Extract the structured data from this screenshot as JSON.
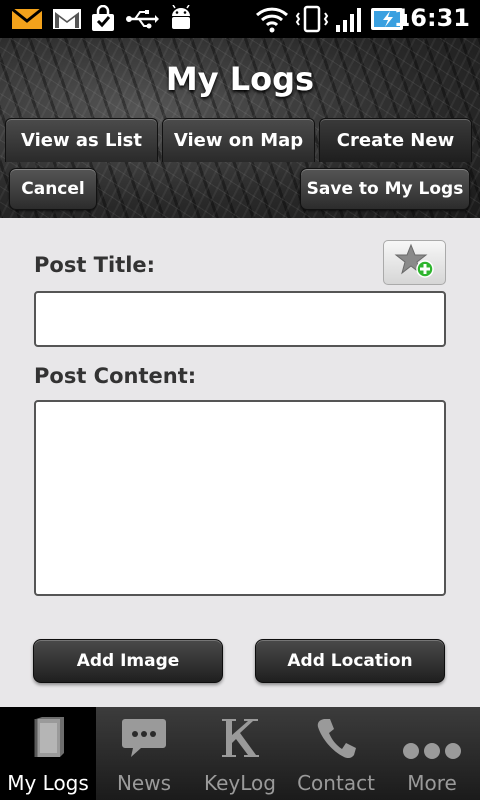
{
  "status_bar": {
    "time": "16:31",
    "icons": [
      "mail-icon",
      "gmail-icon",
      "shopping-bag-icon",
      "usb-icon",
      "android-debug-icon",
      "wifi-icon",
      "vibrate-icon",
      "signal-icon",
      "battery-charging-icon"
    ]
  },
  "header": {
    "title": "My Logs",
    "tabs": [
      {
        "label": "View as List"
      },
      {
        "label": "View on Map"
      },
      {
        "label": "Create New"
      }
    ],
    "cancel_label": "Cancel",
    "save_label": "Save to My Logs"
  },
  "form": {
    "post_title_label": "Post Title:",
    "post_title_value": "",
    "post_content_label": "Post Content:",
    "post_content_value": "",
    "favorite_icon": "star-add-icon",
    "add_image_label": "Add Image",
    "add_location_label": "Add Location"
  },
  "tabbar": {
    "items": [
      {
        "label": "My Logs",
        "icon": "book-icon",
        "selected": true
      },
      {
        "label": "News",
        "icon": "chat-bubble-icon",
        "selected": false
      },
      {
        "label": "KeyLog",
        "icon": "keylog-k-icon",
        "selected": false
      },
      {
        "label": "Contact",
        "icon": "phone-icon",
        "selected": false
      },
      {
        "label": "More",
        "icon": "more-dots-icon",
        "selected": false
      }
    ]
  },
  "colors": {
    "accent_green": "#2fb52f",
    "status_blue": "#3aa0e0"
  }
}
